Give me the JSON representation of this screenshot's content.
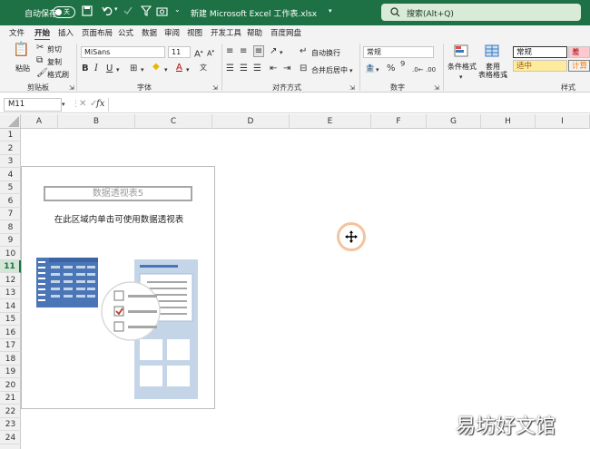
{
  "titlebar": {
    "autosave_label": "自动保存",
    "autosave_state": "关",
    "doc_title": "新建 Microsoft Excel 工作表.xlsx",
    "search_placeholder": "搜索(Alt+Q)"
  },
  "tabs": [
    "文件",
    "开始",
    "插入",
    "页面布局",
    "公式",
    "数据",
    "审阅",
    "视图",
    "开发工具",
    "帮助",
    "百度网盘"
  ],
  "ribbon": {
    "clipboard": {
      "paste": "粘贴",
      "cut": "剪切",
      "copy": "复制",
      "format_painter": "格式刷",
      "label": "剪贴板"
    },
    "font": {
      "name": "MiSans",
      "size": "11",
      "label": "字体"
    },
    "alignment": {
      "wrap_text": "自动换行",
      "merge_center": "合并后居中",
      "label": "对齐方式"
    },
    "number": {
      "format": "常规",
      "label": "数字"
    },
    "styles": {
      "conditional": "条件格式",
      "table_format_1": "套用",
      "table_format_2": "表格格式",
      "normal": "常规",
      "bad": "差",
      "neutral": "适中",
      "calc": "计算",
      "label": "样式"
    }
  },
  "formula_bar": {
    "cell_ref": "M11",
    "value": ""
  },
  "columns": [
    "A",
    "B",
    "C",
    "D",
    "E",
    "F",
    "G",
    "H",
    "I"
  ],
  "rows": [
    "1",
    "2",
    "3",
    "4",
    "5",
    "6",
    "7",
    "8",
    "9",
    "10",
    "11",
    "12",
    "13",
    "14",
    "15",
    "16",
    "17",
    "18",
    "19",
    "20",
    "21",
    "22",
    "23",
    "24"
  ],
  "selected_row": "11",
  "pivot": {
    "title": "数据透视表5",
    "description": "在此区域内单击可使用数据透视表"
  },
  "watermark": "易坊好文馆",
  "colors": {
    "excel_green": "#1e7145",
    "pivot_blue": "#4a76b8",
    "pivot_light": "#c5d5e8",
    "check_red": "#c0392b"
  }
}
